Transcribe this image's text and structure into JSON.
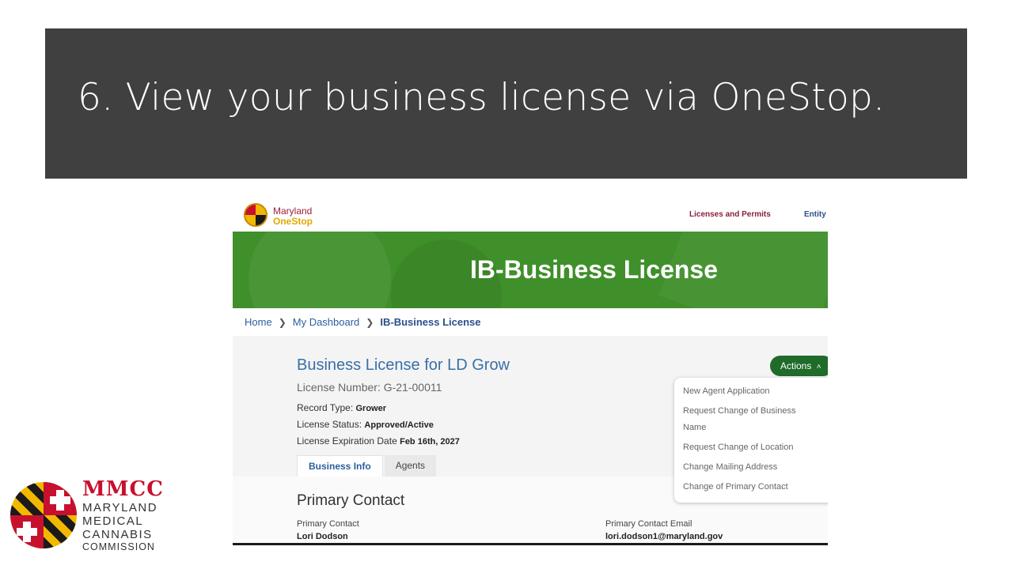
{
  "slide": {
    "title": "6.  View your business license via OneStop."
  },
  "site": {
    "logo_line1": "Maryland",
    "logo_line2": "OneStop",
    "nav_licenses": "Licenses and Permits",
    "nav_entity": "Entity"
  },
  "hero": {
    "title": "IB-Business License"
  },
  "breadcrumb": {
    "home": "Home",
    "dashboard": "My Dashboard",
    "current": "IB-Business License"
  },
  "license": {
    "title": "Business License for LD Grow",
    "number": "License Number: G-21-00011",
    "record_type_label": "Record Type:",
    "record_type_value": "Grower",
    "status_label": "License Status:",
    "status_value": "Approved/Active",
    "expiration_label": "License Expiration Date",
    "expiration_value": "Feb 16th, 2027"
  },
  "tabs": {
    "business_info": "Business Info",
    "agents": "Agents"
  },
  "actions": {
    "button_label": "Actions",
    "menu": [
      "New Agent Application",
      "Request Change of Business Name",
      "Request Change of Location",
      "Change Mailing Address",
      "Change of Primary Contact"
    ]
  },
  "primary_contact": {
    "heading": "Primary Contact",
    "name_label": "Primary Contact",
    "name_value": "Lori Dodson",
    "email_label": "Primary Contact Email",
    "email_value": "lori.dodson1@maryland.gov"
  },
  "mmcc": {
    "abbr": "MMCC",
    "line1": "MARYLAND",
    "line2": "MEDICAL",
    "line3": "CANNABIS",
    "line4": "COMMISSION"
  },
  "colors": {
    "banner": "#404040",
    "hero_green": "#3f8f2a",
    "actions_green": "#1f6b2a",
    "link_blue": "#2b5f9e",
    "mmcc_red": "#c8102e"
  }
}
